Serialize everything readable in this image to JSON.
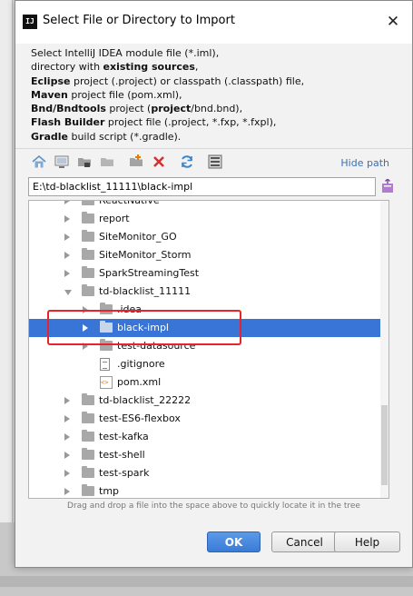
{
  "window": {
    "title": "Select File or Directory to Import",
    "app_icon": "IJ",
    "close_glyph": "✕"
  },
  "description": {
    "lines": [
      [
        {
          "t": "Select IntelliJ IDEA module file (*.iml),",
          "b": false
        }
      ],
      [
        {
          "t": "directory with ",
          "b": false
        },
        {
          "t": "existing sources",
          "b": true
        },
        {
          "t": ",",
          "b": false
        }
      ],
      [
        {
          "t": "Eclipse",
          "b": true
        },
        {
          "t": " project (.project) or classpath (.classpath) file,",
          "b": false
        }
      ],
      [
        {
          "t": "Maven",
          "b": true
        },
        {
          "t": " project file (pom.xml),",
          "b": false
        }
      ],
      [
        {
          "t": "Bnd/Bndtools",
          "b": true
        },
        {
          "t": " project (",
          "b": false
        },
        {
          "t": "project",
          "b": true
        },
        {
          "t": "/bnd.bnd),",
          "b": false
        }
      ],
      [
        {
          "t": "Flash Builder",
          "b": true
        },
        {
          "t": " project file (.project, *.fxp, *.fxpl),",
          "b": false
        }
      ],
      [
        {
          "t": "Gradle",
          "b": true
        },
        {
          "t": " build script (*.gradle).",
          "b": false
        }
      ]
    ]
  },
  "toolbar": {
    "icons": [
      "home-icon",
      "desktop-icon",
      "project-folder-icon",
      "module-folder-icon",
      "new-folder-icon",
      "delete-icon",
      "refresh-icon",
      "show-hidden-icon"
    ],
    "hide_path_label": "Hide path"
  },
  "path": {
    "value": "E:\\td-blacklist_11111\\black-impl"
  },
  "tree": {
    "rows": [
      {
        "label": "ReactNative",
        "indent": 0,
        "arrow": "right",
        "icon": "folder",
        "selected": false
      },
      {
        "label": "report",
        "indent": 0,
        "arrow": "right",
        "icon": "folder",
        "selected": false
      },
      {
        "label": "SiteMonitor_GO",
        "indent": 0,
        "arrow": "right",
        "icon": "folder",
        "selected": false
      },
      {
        "label": "SiteMonitor_Storm",
        "indent": 0,
        "arrow": "right",
        "icon": "folder",
        "selected": false
      },
      {
        "label": "SparkStreamingTest",
        "indent": 0,
        "arrow": "right",
        "icon": "folder",
        "selected": false
      },
      {
        "label": "td-blacklist_11111",
        "indent": 0,
        "arrow": "down",
        "icon": "folder",
        "selected": false
      },
      {
        "label": ".idea",
        "indent": 1,
        "arrow": "right",
        "icon": "folder",
        "selected": false
      },
      {
        "label": "black-impl",
        "indent": 1,
        "arrow": "right",
        "icon": "folder",
        "selected": true
      },
      {
        "label": "test-datasource",
        "indent": 1,
        "arrow": "right",
        "icon": "folder",
        "selected": false
      },
      {
        "label": ".gitignore",
        "indent": 1,
        "arrow": "none",
        "icon": "file",
        "selected": false
      },
      {
        "label": "pom.xml",
        "indent": 1,
        "arrow": "none",
        "icon": "pom",
        "selected": false
      },
      {
        "label": "td-blacklist_22222",
        "indent": 0,
        "arrow": "right",
        "icon": "folder",
        "selected": false
      },
      {
        "label": "test-ES6-flexbox",
        "indent": 0,
        "arrow": "right",
        "icon": "folder",
        "selected": false
      },
      {
        "label": "test-kafka",
        "indent": 0,
        "arrow": "right",
        "icon": "folder",
        "selected": false
      },
      {
        "label": "test-shell",
        "indent": 0,
        "arrow": "right",
        "icon": "folder",
        "selected": false
      },
      {
        "label": "test-spark",
        "indent": 0,
        "arrow": "right",
        "icon": "folder",
        "selected": false
      },
      {
        "label": "tmp",
        "indent": 0,
        "arrow": "right",
        "icon": "folder",
        "selected": false
      }
    ]
  },
  "hint": "Drag and drop a file into the space above to quickly locate it in the tree",
  "buttons": {
    "ok": "OK",
    "cancel": "Cancel",
    "help": "Help"
  },
  "colors": {
    "selection": "#3875d7",
    "highlight_box": "#e8232a",
    "link": "#3b6fb6"
  }
}
